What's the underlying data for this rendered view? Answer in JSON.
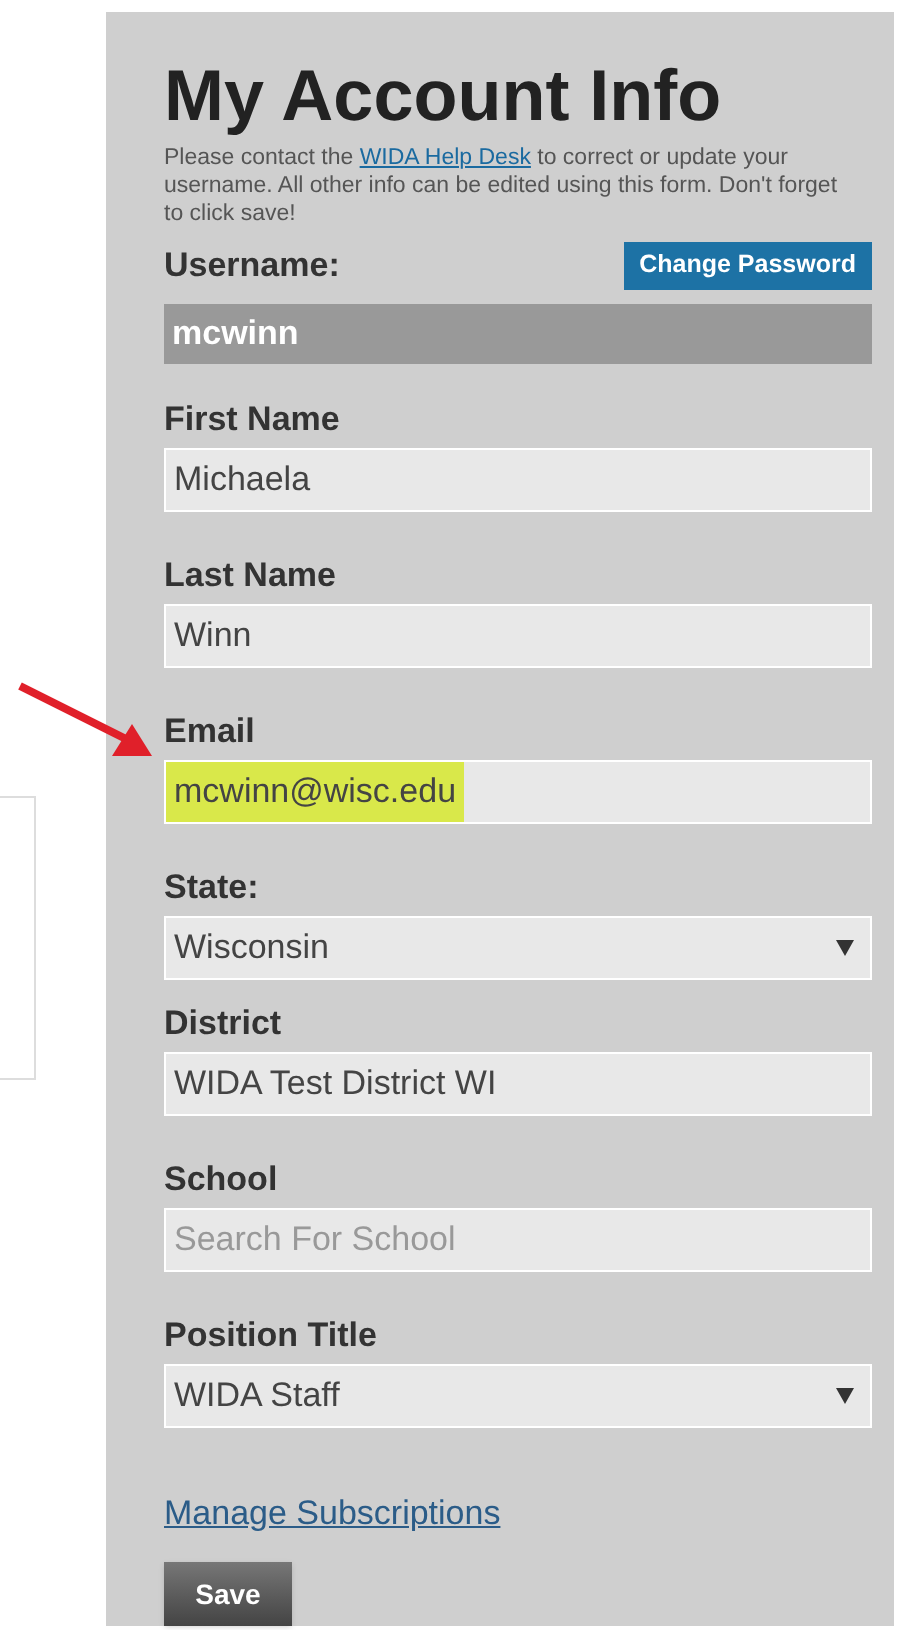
{
  "title": "My Account Info",
  "intro": {
    "before": "Please contact the ",
    "link": "WIDA Help Desk",
    "after": " to correct or update your username. All other info can be edited using this form. Don't forget to click save!"
  },
  "username": {
    "label": "Username:",
    "value": "mcwinn",
    "button": "Change Password"
  },
  "fields": [
    {
      "kind": "input",
      "label": "First Name",
      "value": "Michaela",
      "highlighted": false
    },
    {
      "kind": "input",
      "label": "Last Name",
      "value": "Winn",
      "highlighted": false
    },
    {
      "kind": "input",
      "label": "Email",
      "value": "mcwinn@wisc.edu",
      "highlighted": true
    },
    {
      "kind": "select",
      "label": "State:",
      "value": "Wisconsin",
      "highlighted": false
    },
    {
      "kind": "input",
      "label": "District",
      "value": "WIDA Test District WI",
      "highlighted": false
    },
    {
      "kind": "input",
      "label": "School",
      "placeholder": "Search For School",
      "highlighted": false
    },
    {
      "kind": "select",
      "label": "Position Title",
      "value": "WIDA Staff",
      "highlighted": false
    }
  ],
  "subscriptions_link": "Manage Subscriptions",
  "save_button": "Save"
}
